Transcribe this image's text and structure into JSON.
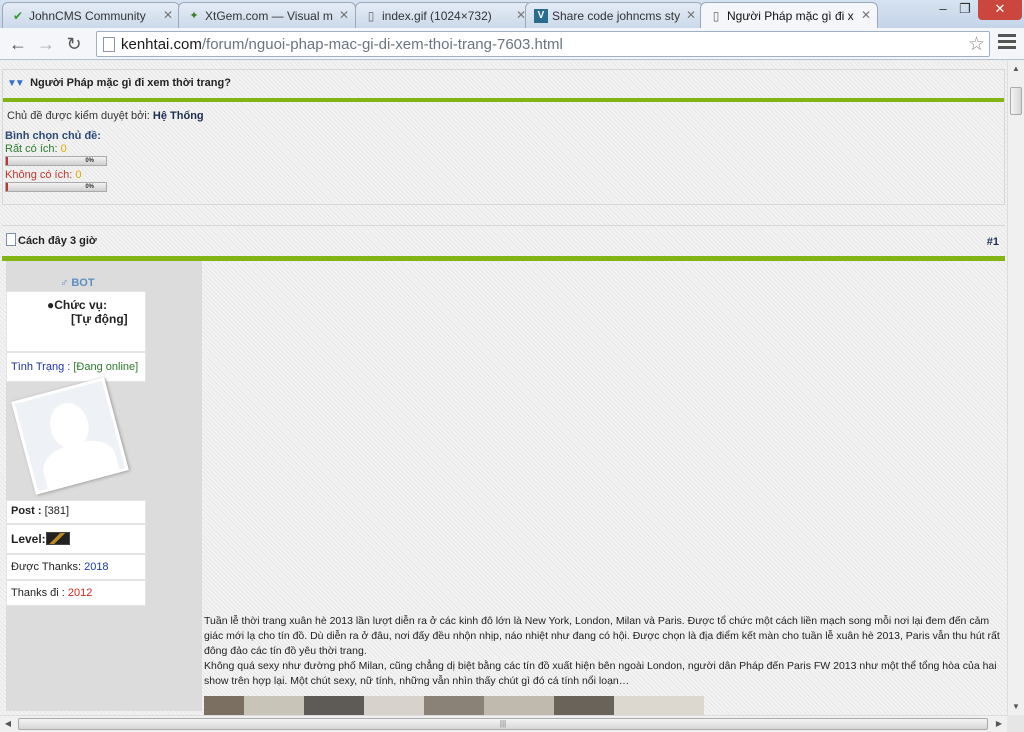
{
  "tabs": [
    {
      "label": "JohnCMS Community",
      "icon": "check-icon"
    },
    {
      "label": "XtGem.com — Visual m",
      "icon": "xtgem-icon"
    },
    {
      "label": "index.gif (1024×732)",
      "icon": "page-icon"
    },
    {
      "label": "Share code johncms sty",
      "icon": "share-icon"
    },
    {
      "label": "Người Pháp mặc gì đi x",
      "icon": "page-icon"
    }
  ],
  "toolbar": {
    "url_domain": "kenhtai.com",
    "url_path": "/forum/nguoi-phap-mac-gi-di-xem-thoi-trang-7603.html"
  },
  "topic": {
    "title": "Người Pháp mặc gì đi xem thời trang?",
    "moderated_label": "Chủ đề được kiểm duyệt bởi:",
    "moderated_by": "Hệ Thống",
    "poll_title": "Bình chọn chủ đề:",
    "vote_yes_label": "Rất có ích:",
    "vote_yes_count": "0",
    "vote_yes_pct": "0%",
    "vote_no_label": "Không có ích:",
    "vote_no_count": "0",
    "vote_no_pct": "0%"
  },
  "post": {
    "time": "Cách đây 3 giờ",
    "number": "#1",
    "user_role_badge": "BOT",
    "role_label": "●Chức vụ:",
    "role_value": "[Tự động]",
    "status_label": "Tình Trạng :",
    "status_value": "[Đang online]",
    "posts_label": "Post :",
    "posts_value": "[381]",
    "level_label": "Level:",
    "thanks_received_label": "Được Thanks:",
    "thanks_received_value": "2018",
    "thanks_given_label": "Thanks đi :",
    "thanks_given_value": "2012",
    "paragraph_1": "Tuần lễ thời trang xuân hè 2013 lần lượt diễn ra ở các kinh đô lớn là New York, London, Milan và Paris. Được tổ chức một cách liền mạch song mỗi nơi lại đem đến cảm giác mới lạ cho tín đồ. Dù diễn ra ở đâu, nơi đấy đều nhộn nhịp, náo nhiệt như đang có hội. Được chọn là địa điểm kết màn cho tuần lễ xuân hè 2013, Paris vẫn thu hút rất đông đảo các tín đồ yêu thời trang.",
    "paragraph_2": "Không quá sexy như đường phố Milan, cũng chẳng dị biệt bằng các tín đồ xuất hiện bên ngoài London, người dân Pháp đến Paris FW 2013 như một thể tổng hòa của hai show trên hợp lại. Một chút sexy, nữ tính, những vẫn nhìn thấy chút gì đó cá tính nổi loạn…"
  }
}
